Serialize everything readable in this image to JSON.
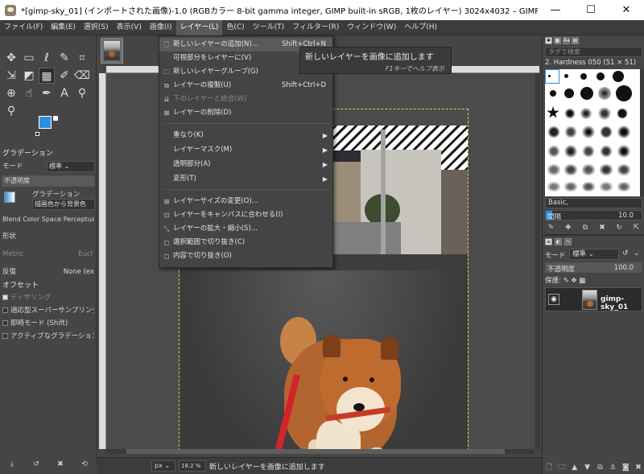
{
  "window": {
    "title": "*[gimp-sky_01] (インポートされた画像)-1.0 (RGBカラー 8-bit gamma integer, GIMP built-in sRGB, 1枚のレイヤー) 3024x4032 – GIMP",
    "minimize": "—",
    "maximize": "☐",
    "close": "✕"
  },
  "menubar": {
    "file": "ファイル(F)",
    "edit": "編集(E)",
    "select": "選択(S)",
    "view": "表示(V)",
    "image": "画像(I)",
    "layer": "レイヤー(L)",
    "colors": "色(C)",
    "tools": "ツール(T)",
    "filters": "フィルター(R)",
    "windows": "ウィンドウ(W)",
    "help": "ヘルプ(H)"
  },
  "layer_menu": {
    "items": [
      {
        "label": "新しいレイヤーの追加(N)...",
        "shortcut": "Shift+Ctrl+N",
        "icon": "new-layer-icon"
      },
      {
        "label": "可視部分をレイヤーに(V)",
        "shortcut": "",
        "icon": ""
      },
      {
        "label": "新しいレイヤーグループ(G)",
        "shortcut": "",
        "icon": "layer-group-icon"
      },
      {
        "label": "レイヤーの複製(U)",
        "shortcut": "Shift+Ctrl+D",
        "icon": "duplicate-icon"
      },
      {
        "label": "下のレイヤーと統合(W)",
        "shortcut": "",
        "icon": "merge-down-icon",
        "disabled": true
      },
      {
        "label": "レイヤーの削除(D)",
        "shortcut": "",
        "icon": "delete-icon"
      },
      {
        "label": "重なり(K)",
        "submenu": true
      },
      {
        "label": "レイヤーマスク(M)",
        "submenu": true
      },
      {
        "label": "透明部分(A)",
        "submenu": true
      },
      {
        "label": "変形(T)",
        "submenu": true
      },
      {
        "label": "レイヤーサイズの変更(O)...",
        "icon": "layer-size-icon"
      },
      {
        "label": "レイヤーをキャンバスに合わせる(I)",
        "icon": "layer-to-canvas-icon"
      },
      {
        "label": "レイヤーの拡大・縮小(S)...",
        "icon": "scale-icon"
      },
      {
        "label": "選択範囲で切り抜き(C)",
        "icon": "crop-selection-icon"
      },
      {
        "label": "内容で切り抜き(O)",
        "icon": "crop-content-icon"
      }
    ]
  },
  "tooltip": {
    "text": "新しいレイヤーを画像に追加します",
    "hint": "F1キーでヘルプ表示"
  },
  "tool_options": {
    "header": "グラデーション",
    "mode_label": "モード",
    "mode_value": "標準",
    "opacity_label": "不透明度",
    "gradient_label": "グラデーション",
    "gradient_value": "描画色から背景色",
    "blend_space_label": "Blend Color Space",
    "blend_space_value": "Perceptual",
    "shape_label": "形状",
    "metric_label": "Metric",
    "metric_value": "Eucl",
    "repeat_label": "反復",
    "repeat_value": "None (ex",
    "offset_label": "オフセット",
    "dither_label": "ディザリング",
    "adaptive_label": "適応型スーパーサンプリング",
    "instant_label": "即時モード (Shift)",
    "active_label": "アクティブなグラデーション"
  },
  "brushes": {
    "search_placeholder": "タグで検索",
    "current_brush": "2. Hardness 050 (51 × 51)",
    "preset": "Basic,",
    "spacing_label": "間隔",
    "spacing_value": "10.0"
  },
  "layers": {
    "mode_label": "モード",
    "mode_value": "標準",
    "opacity_label": "不透明度",
    "opacity_value": "100.0",
    "lock_label": "保護:",
    "layer_name": "gimp-sky_01"
  },
  "statusbar": {
    "unit": "px",
    "zoom": "18.2 %",
    "message": "新しいレイヤーを画像に追加します"
  }
}
